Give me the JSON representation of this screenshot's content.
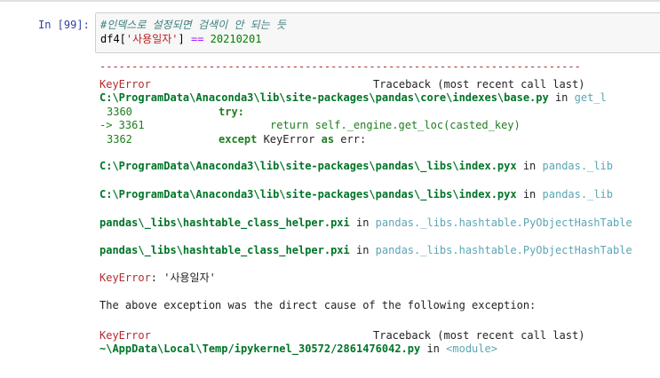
{
  "cell": {
    "prompt": "In [99]:",
    "code_comment": "#인덱스로 설정되면 검색이 안 되는 듯",
    "code_line2": {
      "df": "df4[",
      "key": "'사용일자'",
      "close": "] ",
      "op": "==",
      "num": "20210201"
    }
  },
  "traceback": {
    "dashes": "---------------------------------------------------------------------------",
    "err1_name": "KeyError",
    "err1_tb": "Traceback (most recent call last)",
    "frame1_path": "C:\\ProgramData\\Anaconda3\\lib\\site-packages\\pandas\\core\\indexes\\base.py",
    "frame1_in": " in ",
    "frame1_func": "get_l",
    "l3360_no": "3360",
    "l3360_code": "try:",
    "l3361_no": "-> 3361",
    "l3361_code": "return self._engine.get_loc(casted_key)",
    "l3362_no": "3362",
    "l3362_kw1": "except",
    "l3362_mid": " KeyError ",
    "l3362_kw2": "as",
    "l3362_end": " err:",
    "frame2_path": "C:\\ProgramData\\Anaconda3\\lib\\site-packages\\pandas\\_libs\\index.pyx",
    "frame2_in": " in ",
    "frame2_func": "pandas._lib",
    "frame3_path": "C:\\ProgramData\\Anaconda3\\lib\\site-packages\\pandas\\_libs\\index.pyx",
    "frame3_in": " in ",
    "frame3_func": "pandas._lib",
    "frame4_path": "pandas\\_libs\\hashtable_class_helper.pxi",
    "frame4_in": " in ",
    "frame4_func": "pandas._libs.hashtable.PyObjectHashTable",
    "frame5_path": "pandas\\_libs\\hashtable_class_helper.pxi",
    "frame5_in": " in ",
    "frame5_func": "pandas._libs.hashtable.PyObjectHashTable",
    "keyerror_name": "KeyError",
    "keyerror_msg": ": '사용일자'",
    "cause_msg": "The above exception was the direct cause of the following exception:",
    "err2_name": "KeyError",
    "err2_tb": "Traceback (most recent call last)",
    "frame6_path": "~\\AppData\\Local\\Temp/ipykernel_30572/2861476042.py",
    "frame6_in": " in ",
    "frame6_func": "<module>"
  }
}
